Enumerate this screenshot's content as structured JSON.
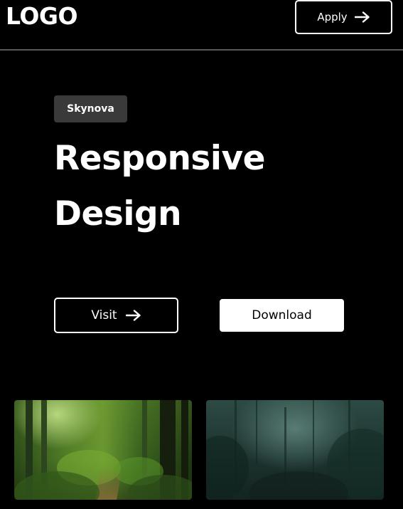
{
  "header": {
    "logo_text": "LOGO",
    "apply_label": "Apply",
    "apply_icon": "arrow-right-icon"
  },
  "hero": {
    "tag": "Skynova",
    "title_line1": "Responsive",
    "title_line2": "Design",
    "visit_label": "Visit",
    "visit_icon": "arrow-right-icon",
    "download_label": "Download"
  },
  "gallery": {
    "images": [
      {
        "name": "forest-path-image"
      },
      {
        "name": "misty-forest-image"
      }
    ]
  },
  "colors": {
    "background": "#000000",
    "tag_background": "#3a3a3a",
    "divider": "#5a5a5a",
    "text": "#ffffff"
  }
}
